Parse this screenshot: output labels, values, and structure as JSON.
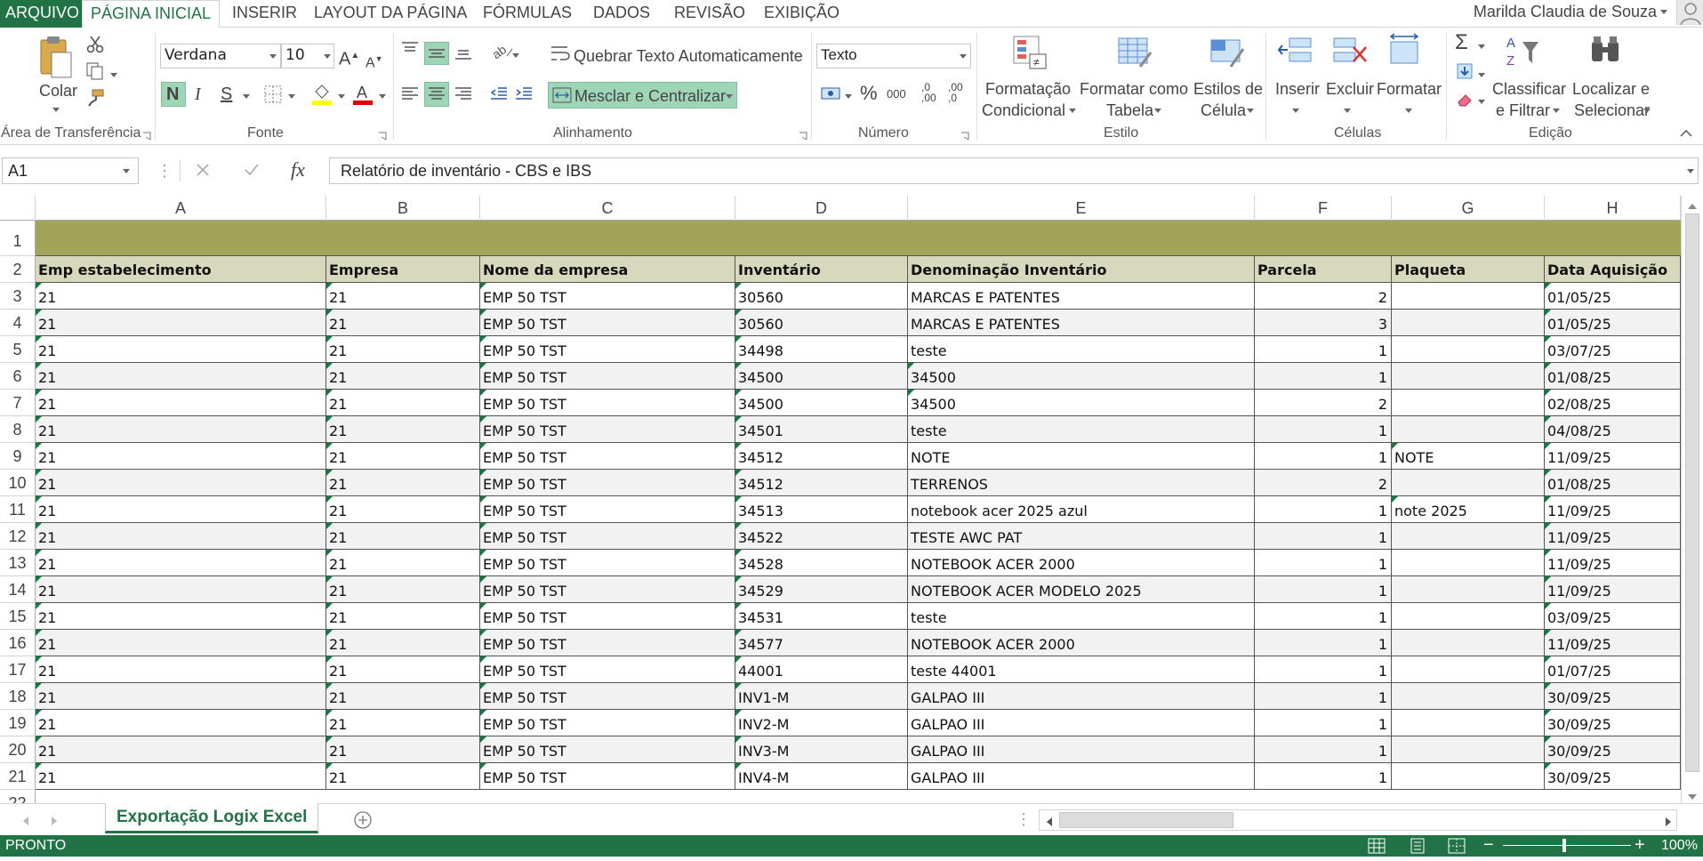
{
  "tabs": {
    "file": "ARQUIVO",
    "items": [
      "PÁGINA INICIAL",
      "INSERIR",
      "LAYOUT DA PÁGINA",
      "FÓRMULAS",
      "DADOS",
      "REVISÃO",
      "EXIBIÇÃO"
    ]
  },
  "user": {
    "name": "Marilda Claudia de Souza"
  },
  "ribbon": {
    "clipboard": {
      "paste": "Colar",
      "label": "Área de Transferência"
    },
    "font": {
      "family": "Verdana",
      "size": "10",
      "bold": "N",
      "italic": "I",
      "underline": "S",
      "label": "Fonte"
    },
    "alignment": {
      "wrap": "Quebrar Texto Automaticamente",
      "merge": "Mesclar e Centralizar",
      "label": "Alinhamento"
    },
    "number": {
      "format": "Texto",
      "percent": "%",
      "thousands": "000",
      "inc_dec": ",0 ,00",
      "dec_dec": ",00 ,0",
      "label": "Número"
    },
    "styles": {
      "cond_format_1": "Formatação",
      "cond_format_2": "Condicional",
      "format_table_1": "Formatar como",
      "format_table_2": "Tabela",
      "cell_styles_1": "Estilos de",
      "cell_styles_2": "Célula",
      "label": "Estilo"
    },
    "cells": {
      "insert": "Inserir",
      "delete": "Excluir",
      "format": "Formatar",
      "label": "Células"
    },
    "editing": {
      "sort_1": "Classificar",
      "sort_2": "e Filtrar",
      "find_1": "Localizar e",
      "find_2": "Selecionar",
      "label": "Edição"
    }
  },
  "formula": {
    "namebox": "A1",
    "fx": "fx",
    "content": "Relatório de inventário - CBS e IBS"
  },
  "sheet": {
    "columns": [
      "A",
      "B",
      "C",
      "D",
      "E",
      "F",
      "G",
      "H"
    ],
    "headers": [
      "Emp estabelecimento",
      "Empresa",
      "Nome da empresa",
      "Inventário",
      "Denominação Inventário",
      "Parcela",
      "Plaqueta",
      "Data Aquisição"
    ],
    "rows": [
      [
        "21",
        "21",
        "EMP 50 TST",
        "30560",
        "MARCAS E PATENTES",
        "2",
        "",
        "01/05/25"
      ],
      [
        "21",
        "21",
        "EMP 50 TST",
        "30560",
        "MARCAS E PATENTES",
        "3",
        "",
        "01/05/25"
      ],
      [
        "21",
        "21",
        "EMP 50 TST",
        "34498",
        "teste",
        "1",
        "",
        "03/07/25"
      ],
      [
        "21",
        "21",
        "EMP 50 TST",
        "34500",
        "34500",
        "1",
        "",
        "01/08/25"
      ],
      [
        "21",
        "21",
        "EMP 50 TST",
        "34500",
        "34500",
        "2",
        "",
        "02/08/25"
      ],
      [
        "21",
        "21",
        "EMP 50 TST",
        "34501",
        "teste",
        "1",
        "",
        "04/08/25"
      ],
      [
        "21",
        "21",
        "EMP 50 TST",
        "34512",
        "NOTE",
        "1",
        "NOTE",
        "11/09/25"
      ],
      [
        "21",
        "21",
        "EMP 50 TST",
        "34512",
        "TERRENOS",
        "2",
        "",
        "01/08/25"
      ],
      [
        "21",
        "21",
        "EMP 50 TST",
        "34513",
        "notebook acer 2025 azul",
        "1",
        "note 2025",
        "11/09/25"
      ],
      [
        "21",
        "21",
        "EMP 50 TST",
        "34522",
        "TESTE AWC PAT",
        "1",
        "",
        "11/09/25"
      ],
      [
        "21",
        "21",
        "EMP 50 TST",
        "34528",
        "NOTEBOOK ACER 2000",
        "1",
        "",
        "11/09/25"
      ],
      [
        "21",
        "21",
        "EMP 50 TST",
        "34529",
        "NOTEBOOK ACER MODELO 2025",
        "1",
        "",
        "11/09/25"
      ],
      [
        "21",
        "21",
        "EMP 50 TST",
        "34531",
        "teste",
        "1",
        "",
        "03/09/25"
      ],
      [
        "21",
        "21",
        "EMP 50 TST",
        "34577",
        "NOTEBOOK ACER 2000",
        "1",
        "",
        "11/09/25"
      ],
      [
        "21",
        "21",
        "EMP 50 TST",
        "44001",
        "teste 44001",
        "1",
        "",
        "01/07/25"
      ],
      [
        "21",
        "21",
        "EMP 50 TST",
        "INV1-M",
        "GALPAO III",
        "1",
        "",
        "30/09/25"
      ],
      [
        "21",
        "21",
        "EMP 50 TST",
        "INV2-M",
        "GALPAO III",
        "1",
        "",
        "30/09/25"
      ],
      [
        "21",
        "21",
        "EMP 50 TST",
        "INV3-M",
        "GALPAO III",
        "1",
        "",
        "30/09/25"
      ],
      [
        "21",
        "21",
        "EMP 50 TST",
        "INV4-M",
        "GALPAO III",
        "1",
        "",
        "30/09/25"
      ]
    ],
    "tab_name": "Exportação Logix Excel"
  },
  "status": {
    "text": "PRONTO",
    "zoom": "100%"
  },
  "colors": {
    "accent": "#217346",
    "band": "#a0a55a",
    "header_fill": "#d8d8bd",
    "stripe": "#f2f2f2"
  }
}
